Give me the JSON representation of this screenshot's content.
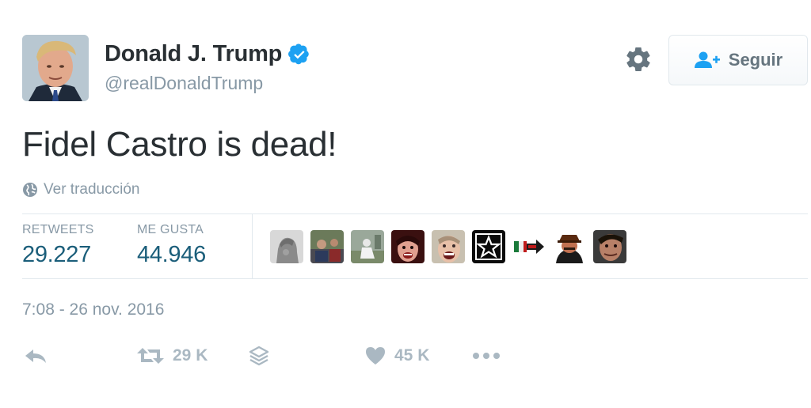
{
  "user": {
    "name": "Donald J. Trump",
    "handle": "@realDonaldTrump",
    "verified": true,
    "avatar_icon": "profile-photo"
  },
  "header": {
    "settings_icon": "gear-icon",
    "follow_button": {
      "icon": "add-user-icon",
      "label": "Seguir"
    }
  },
  "tweet": {
    "text": "Fidel Castro is dead!",
    "translate_label": "Ver traducción",
    "timestamp": "7:08 - 26 nov. 2016"
  },
  "stats": {
    "retweets": {
      "label": "RETWEETS",
      "value": "29.227"
    },
    "likes": {
      "label": "ME GUSTA",
      "value": "44.946"
    }
  },
  "likers": [
    {
      "name": "liker-avatar-1"
    },
    {
      "name": "liker-avatar-2"
    },
    {
      "name": "liker-avatar-3"
    },
    {
      "name": "liker-avatar-4"
    },
    {
      "name": "liker-avatar-5"
    },
    {
      "name": "liker-avatar-6"
    },
    {
      "name": "liker-avatar-7"
    },
    {
      "name": "liker-avatar-8"
    },
    {
      "name": "liker-avatar-9"
    }
  ],
  "actions": {
    "reply": {
      "icon": "reply-icon"
    },
    "retweet": {
      "icon": "retweet-icon",
      "count": "29 K"
    },
    "stack": {
      "icon": "layers-icon"
    },
    "like": {
      "icon": "heart-icon",
      "count": "45 K"
    },
    "more": {
      "icon": "more-icon"
    }
  },
  "colors": {
    "text": "#292f33",
    "secondary": "#8899a6",
    "verified_blue": "#1da1f2",
    "action_grey": "#aab8c2",
    "border": "#e1e8ed"
  }
}
